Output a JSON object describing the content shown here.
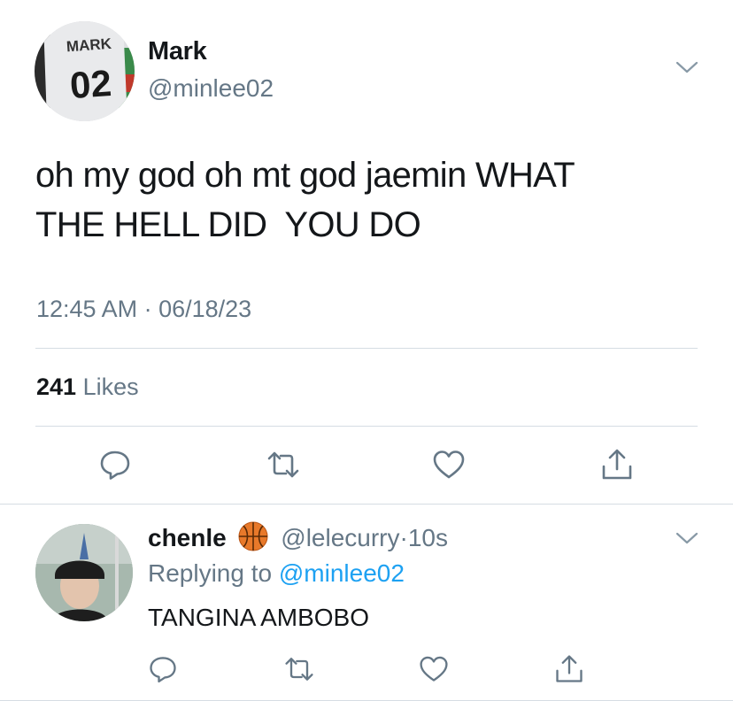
{
  "main_tweet": {
    "author_name": "Mark",
    "author_handle": "@minlee02",
    "jersey_text": "MARK",
    "jersey_number": "02",
    "text": "oh my god oh mt god jaemin WHAT\nTHE HELL DID  YOU DO",
    "timestamp": "12:45 AM · 06/18/23",
    "likes_count": "241",
    "likes_label": "Likes",
    "actions": [
      "reply-icon",
      "retweet-icon",
      "like-icon",
      "share-icon"
    ]
  },
  "reply": {
    "author_name": "chenle",
    "emoji": "basketball",
    "author_handle": "@lelecurry",
    "separator": "·",
    "time": "10s",
    "replying_prefix": "Replying to ",
    "replying_handle": "@minlee02",
    "text": "TANGINA AMBOBO",
    "actions": [
      "reply-icon",
      "retweet-icon",
      "like-icon",
      "share-icon"
    ]
  },
  "colors": {
    "text_primary": "#14171a",
    "text_secondary": "#657786",
    "link": "#1da1f2",
    "divider": "#d6dde3",
    "icon": "#657786"
  }
}
